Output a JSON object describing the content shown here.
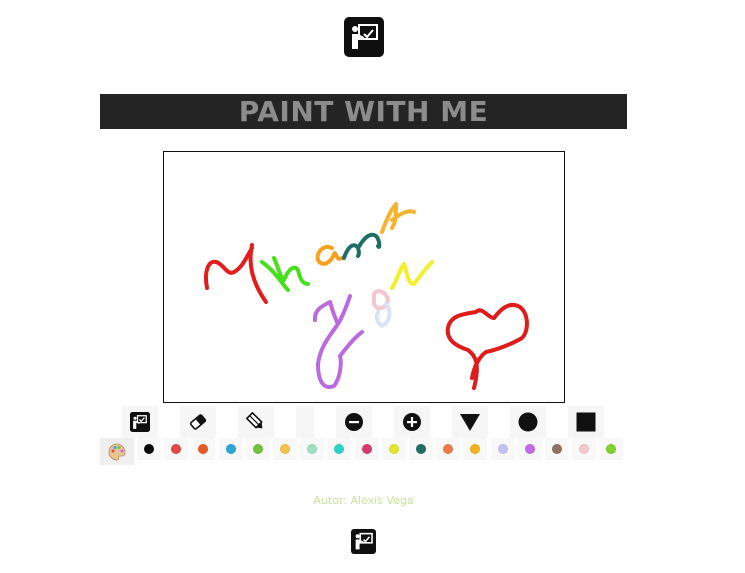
{
  "header": {
    "logo_icon": "teacher-board-icon"
  },
  "banner": {
    "title": "PAINT WITH ME"
  },
  "drawing": {
    "strokes": [
      {
        "color": "#e51c1c",
        "name": "letter-T"
      },
      {
        "color": "#44e01a",
        "name": "letter-h"
      },
      {
        "color": "#f7a11e",
        "name": "letter-a"
      },
      {
        "color": "#1f6e65",
        "name": "letter-n"
      },
      {
        "color": "#f5b32e",
        "name": "letter-k"
      },
      {
        "color": "#ba6be0",
        "name": "letter-y"
      },
      {
        "color": "#f3c6d2",
        "name": "letter-o"
      },
      {
        "color": "#d8e4f4",
        "name": "letter-o-shadow"
      },
      {
        "color": "#f2f029",
        "name": "letter-u"
      },
      {
        "color": "#e01b1b",
        "name": "heart"
      }
    ]
  },
  "toolbar": {
    "tools": [
      {
        "name": "board-tool",
        "icon": "teacher-board-icon"
      },
      {
        "name": "eraser-tool",
        "icon": "eraser-icon"
      },
      {
        "name": "pencil-tool",
        "icon": "pencil-icon"
      },
      {
        "name": "blank-tool",
        "icon": ""
      },
      {
        "name": "decrease-size-button",
        "icon": "minus-circle-icon"
      },
      {
        "name": "increase-size-button",
        "icon": "plus-circle-icon"
      },
      {
        "name": "triangle-brush-button",
        "icon": "triangle-icon"
      },
      {
        "name": "circle-brush-button",
        "icon": "circle-icon"
      },
      {
        "name": "square-brush-button",
        "icon": "square-icon"
      }
    ]
  },
  "palette": {
    "icon": "palette-icon",
    "colors": [
      "#0a0a0a",
      "#e84545",
      "#e85a25",
      "#29a8d8",
      "#75c23a",
      "#f2c24c",
      "#9fe0c4",
      "#30d2c8",
      "#d63a6c",
      "#dfe82a",
      "#1e6e62",
      "#f07a4a",
      "#f5b21a",
      "#c3c2f5",
      "#c469e8",
      "#8c7261",
      "#f5c6cf",
      "#80d12a"
    ]
  },
  "footer": {
    "author": "Autor: Alexis Vega",
    "logo_icon": "teacher-board-icon"
  },
  "colors": {
    "banner_bg": "#242424",
    "title_text": "#8c8c8c",
    "author_text": "#c6e59b"
  }
}
